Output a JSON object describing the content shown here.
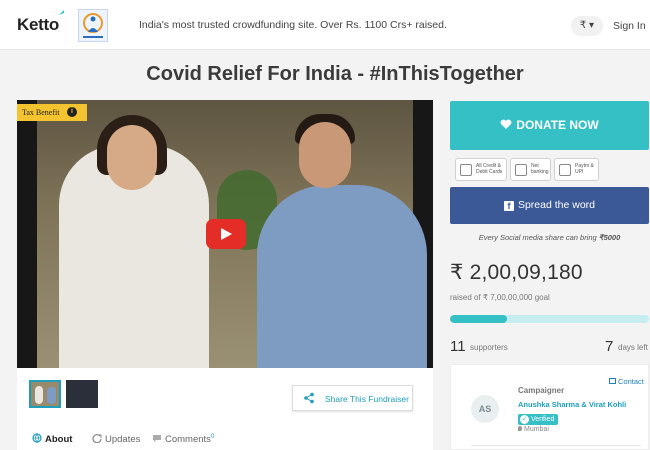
{
  "header": {
    "logo_text": "Ketto",
    "tagline": "India's most trusted crowdfunding site. Over Rs. 1100 Crs+ raised.",
    "currency_label": "₹ ▾",
    "signin_label": "Sign In"
  },
  "page": {
    "title": "Covid Relief For India - #InThisTogether"
  },
  "media": {
    "tax_badge": "Tax Benefit",
    "info_glyph": "i"
  },
  "actions": {
    "share_label": "Share This Fundraiser",
    "donate_label": "DONATE NOW",
    "spread_label": "Spread the word"
  },
  "tabs": [
    {
      "label": "About"
    },
    {
      "label": "Updates"
    },
    {
      "label": "Comments",
      "count": "0"
    }
  ],
  "payment_methods": [
    {
      "label": "All Credit & Debit Cards"
    },
    {
      "label": "Net banking"
    },
    {
      "label": "Paytm & UPI"
    }
  ],
  "fundraiser": {
    "social_note_prefix": "Every Social media share can bring ",
    "social_note_amount": "₹5000",
    "raised": "₹ 2,00,09,180",
    "goal_prefix": "raised of ",
    "goal": "₹ 7,00,00,000",
    "goal_suffix": " goal",
    "progress_fraction": 0.2858,
    "supporters_count": "11",
    "supporters_label": "supporters",
    "days_count": "7",
    "days_label": "days left"
  },
  "campaigner": {
    "initials": "AS",
    "label": "Campaigner",
    "contact_label": "Contact",
    "name": "Anushka Sharma & Virat Kohli",
    "verified_label": "Verified",
    "verified_glyph": "✓",
    "city": "Mumbai"
  },
  "colors": {
    "accent": "#35c0c6",
    "facebook": "#3b5997",
    "tax_badge": "#f3c42f",
    "play": "#e52d27"
  },
  "icons": [
    "ketto-logo",
    "partner-logo",
    "info-icon",
    "play-icon",
    "share-icon",
    "globe-icon",
    "refresh-icon",
    "comment-icon",
    "heart-icon",
    "card-icon",
    "bank-icon",
    "upi-icon",
    "facebook-icon",
    "mail-icon",
    "check-icon",
    "pin-icon"
  ]
}
